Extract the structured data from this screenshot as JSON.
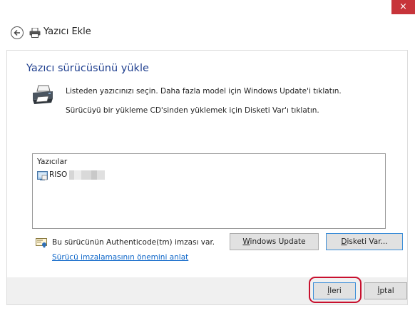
{
  "window": {
    "title": "Yazıcı Ekle",
    "close_glyph": "×"
  },
  "header": {
    "back_icon": "back-arrow-icon",
    "printer_icon": "printer-icon"
  },
  "main": {
    "heading": "Yazıcı sürücüsünü yükle",
    "instruction_1": "Listeden yazıcınızı seçin. Daha fazla model için Windows Update'i tıklatın.",
    "instruction_2": "Sürücüyü bir yükleme CD'sinden yüklemek için Disketi Var'ı tıklatın."
  },
  "printer_list": {
    "header": "Yazıcılar",
    "items": [
      {
        "label": "RISO"
      }
    ]
  },
  "signature": {
    "text": "Bu sürücünün Authenticode(tm) imzası var.",
    "link": "Sürücü imzalamasının önemini anlat"
  },
  "buttons": {
    "windows_update_key": "W",
    "windows_update_rest": "indows Update",
    "have_disk_key": "D",
    "have_disk_rest": "isketi Var...",
    "next_key": "İ",
    "next_rest": "leri",
    "cancel_key": "İ",
    "cancel_rest": "ptal"
  },
  "colors": {
    "heading": "#1f3f8f",
    "link": "#0a64c8",
    "close": "#c7343a",
    "highlight": "#c8102e"
  }
}
